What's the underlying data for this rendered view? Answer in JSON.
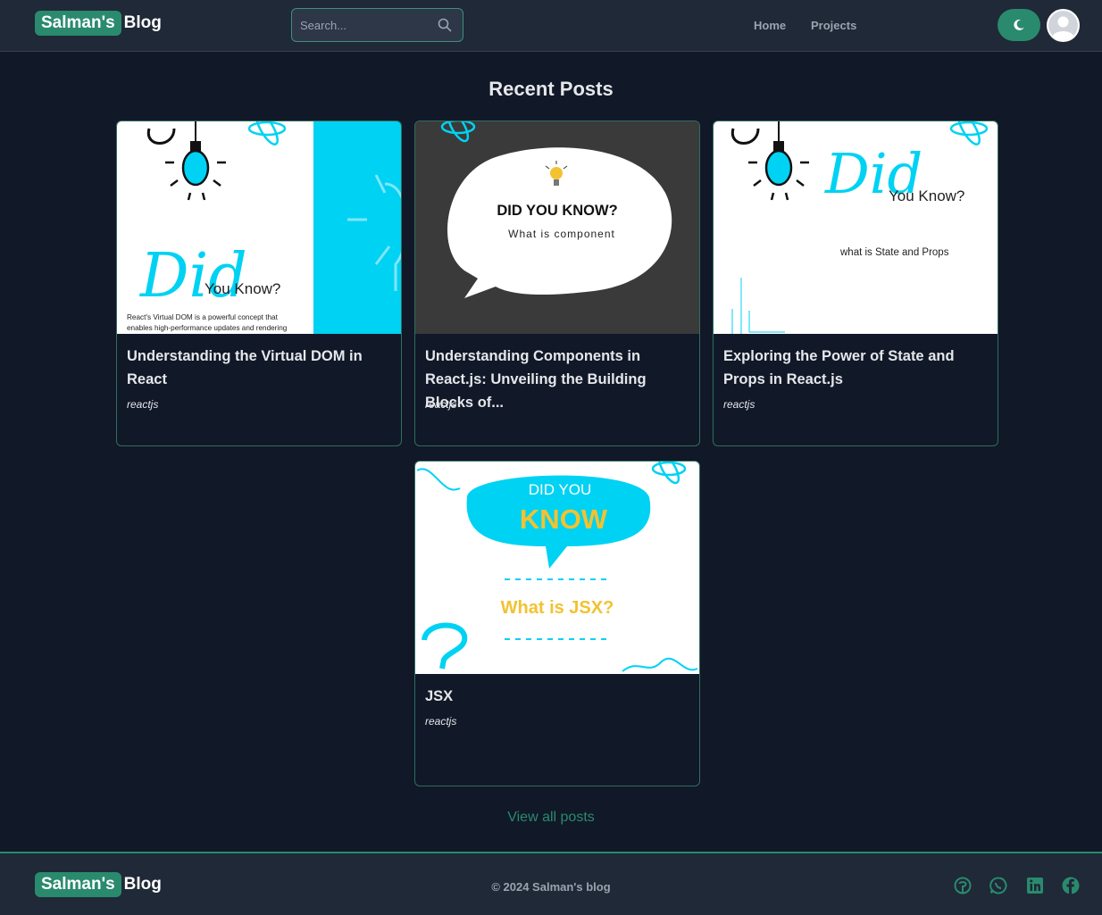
{
  "header": {
    "logo_highlight": "Salman's",
    "logo_rest": "Blog",
    "search_placeholder": "Search...",
    "nav": {
      "home": "Home",
      "projects": "Projects"
    }
  },
  "main": {
    "section_title": "Recent Posts",
    "posts": [
      {
        "title": "Understanding the Virtual DOM in React",
        "tag": "reactjs",
        "thumb": {
          "script": "Did",
          "sub": "You Know?",
          "caption_1": "React's Virtual DOM is a powerful concept that",
          "caption_2": "enables high-performance updates and rendering"
        }
      },
      {
        "title": "Understanding Components in React.js: Unveiling the Building Blocks of...",
        "tag": "reactjs",
        "thumb": {
          "heading": "DID YOU KNOW?",
          "sub": "What is component"
        }
      },
      {
        "title": "Exploring the Power of State and Props in React.js",
        "tag": "reactjs",
        "thumb": {
          "script": "Did",
          "sub": "You Know?",
          "caption": "what is State and Props"
        }
      },
      {
        "title": "JSX",
        "tag": "reactjs",
        "thumb": {
          "line1": "DID YOU",
          "line2": "KNOW",
          "question": "What is JSX?"
        }
      }
    ],
    "view_all": "View all posts"
  },
  "footer": {
    "logo_highlight": "Salman's",
    "logo_rest": "Blog",
    "copyright": "© 2024 Salman's blog",
    "social": [
      "github-icon",
      "whatsapp-icon",
      "linkedin-icon",
      "facebook-icon"
    ]
  },
  "colors": {
    "background": "#111827",
    "surface": "#1f2937",
    "accent": "#2a8a6e",
    "thumb_cyan": "#00d2f3",
    "thumb_yellow": "#f2c230",
    "thumb_dark": "#3a3a3a"
  }
}
